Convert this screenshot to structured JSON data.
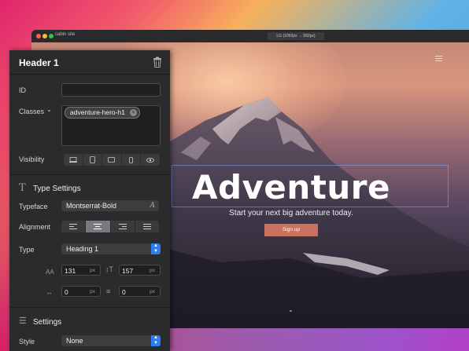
{
  "window": {
    "site_name": "cabin site",
    "size_label": "LG (1092px → 992px)"
  },
  "hero": {
    "title": "Adventure",
    "subtitle": "Start your next big adventure today.",
    "button_label": "Sign up"
  },
  "panel": {
    "title": "Header 1",
    "id_label": "ID",
    "id_value": "",
    "classes_label": "Classes",
    "class_chip": "adventure-hero-h1",
    "visibility_label": "Visibility",
    "visibility_options": [
      "desktop-icon",
      "tablet-icon",
      "tablet-landscape-icon",
      "phone-icon",
      "eye-icon"
    ],
    "type_settings_title": "Type Settings",
    "typeface_label": "Typeface",
    "typeface_value": "Montserrat-Bold",
    "alignment_label": "Alignment",
    "alignment_options": [
      "align-left-icon",
      "align-center-icon",
      "align-right-icon",
      "align-justify-icon"
    ],
    "alignment_selected": "align-center-icon",
    "type_label": "Type",
    "type_value": "Heading 1",
    "font_size": "131",
    "line_height": "157",
    "letter_spacing": "0",
    "paragraph_spacing": "0",
    "unit": "px",
    "settings_title": "Settings",
    "style_label": "Style",
    "style_value": "None"
  },
  "colors": {
    "accent": "#2f7ef0",
    "panel_bg": "#2b2b2d",
    "button": "#c9735f"
  }
}
